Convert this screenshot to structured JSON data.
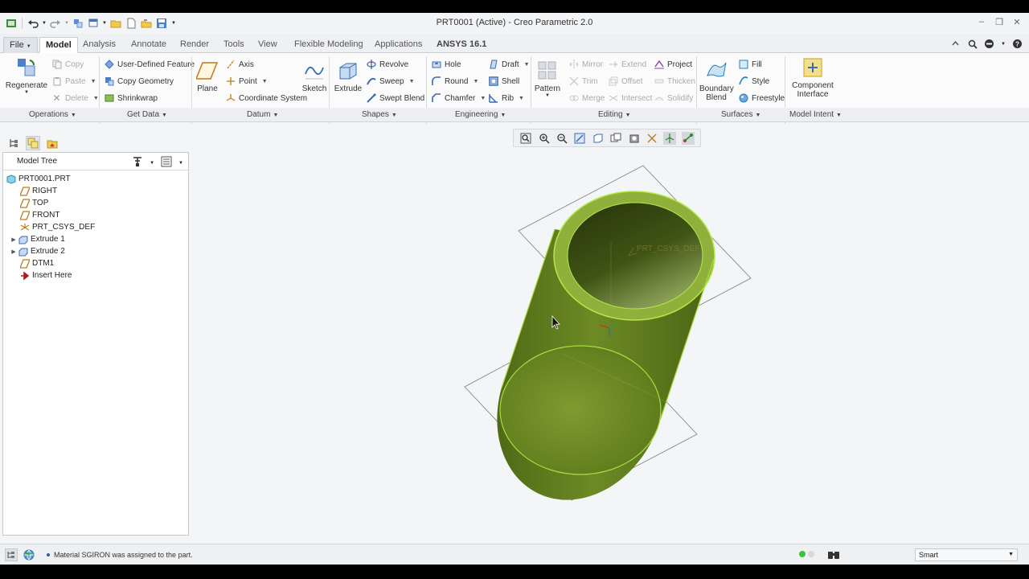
{
  "window": {
    "title": "PRT0001 (Active) - Creo Parametric 2.0"
  },
  "tabs": [
    {
      "label": "File"
    },
    {
      "label": "Model"
    },
    {
      "label": "Analysis"
    },
    {
      "label": "Annotate"
    },
    {
      "label": "Render"
    },
    {
      "label": "Tools"
    },
    {
      "label": "View"
    },
    {
      "label": "Flexible Modeling"
    },
    {
      "label": "Applications"
    },
    {
      "label": "ANSYS 16.1"
    }
  ],
  "ribbon": {
    "operations": {
      "label": "Operations",
      "regenerate": "Regenerate",
      "copy": "Copy",
      "paste": "Paste",
      "delete": "Delete"
    },
    "get_data": {
      "label": "Get Data",
      "user_defined_feature": "User-Defined Feature",
      "copy_geometry": "Copy Geometry",
      "shrinkwrap": "Shrinkwrap"
    },
    "datum": {
      "label": "Datum",
      "plane": "Plane",
      "axis": "Axis",
      "point": "Point",
      "coordinate_system": "Coordinate System",
      "sketch": "Sketch"
    },
    "shapes": {
      "label": "Shapes",
      "extrude": "Extrude",
      "revolve": "Revolve",
      "sweep": "Sweep",
      "swept_blend": "Swept Blend"
    },
    "engineering": {
      "label": "Engineering",
      "hole": "Hole",
      "round": "Round",
      "chamfer": "Chamfer",
      "draft": "Draft",
      "shell": "Shell",
      "rib": "Rib"
    },
    "editing": {
      "label": "Editing",
      "pattern": "Pattern",
      "mirror": "Mirror",
      "trim": "Trim",
      "merge": "Merge",
      "extend": "Extend",
      "offset": "Offset",
      "intersect": "Intersect",
      "project": "Project",
      "thicken": "Thicken",
      "solidify": "Solidify"
    },
    "surfaces": {
      "label": "Surfaces",
      "boundary_blend_1": "Boundary",
      "boundary_blend_2": "Blend",
      "fill": "Fill",
      "style": "Style",
      "freestyle": "Freestyle"
    },
    "model_intent": {
      "label": "Model Intent",
      "component_interface_1": "Component",
      "component_interface_2": "Interface"
    }
  },
  "model_tree": {
    "title": "Model Tree",
    "items": [
      {
        "label": "PRT0001.PRT",
        "icon": "part-icon"
      },
      {
        "label": "RIGHT",
        "icon": "datum-plane-icon"
      },
      {
        "label": "TOP",
        "icon": "datum-plane-icon"
      },
      {
        "label": "FRONT",
        "icon": "datum-plane-icon"
      },
      {
        "label": "PRT_CSYS_DEF",
        "icon": "csys-icon"
      },
      {
        "label": "Extrude 1",
        "icon": "extrude-icon"
      },
      {
        "label": "Extrude 2",
        "icon": "extrude-icon"
      },
      {
        "label": "DTM1",
        "icon": "datum-plane-icon"
      },
      {
        "label": "Insert Here",
        "icon": "insert-arrow-icon"
      }
    ]
  },
  "viewport": {
    "csys_label": "PRT_CSYS_DEF",
    "model_color": "#5f7a1f",
    "highlight_color": "#b6e84a"
  },
  "status": {
    "message": "Material SGIRON was assigned to the part.",
    "selection_filter": "Smart"
  }
}
